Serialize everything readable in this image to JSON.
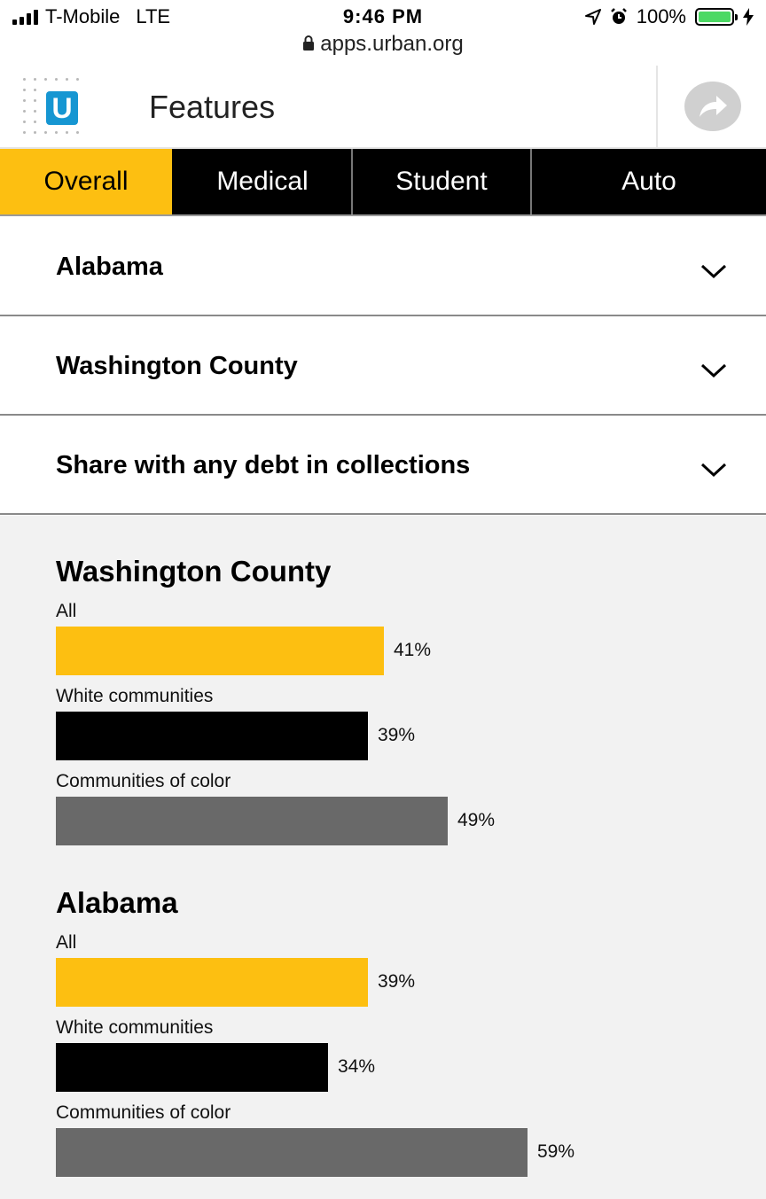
{
  "status_bar": {
    "carrier": "T-Mobile",
    "network": "LTE",
    "time": "9:46 PM",
    "battery": "100%",
    "battery_level": 1.0
  },
  "browser": {
    "url": "apps.urban.org"
  },
  "header": {
    "logo_letter": "U",
    "title": "Features",
    "share_icon": "share-arrow-icon"
  },
  "tabs": [
    {
      "label": "Overall",
      "active": true
    },
    {
      "label": "Medical",
      "active": false
    },
    {
      "label": "Student",
      "active": false
    },
    {
      "label": "Auto",
      "active": false
    }
  ],
  "dropdowns": {
    "state": "Alabama",
    "county": "Washington County",
    "metric": "Share with any debt in collections"
  },
  "colors": {
    "all": "#fdbf11",
    "white": "#000000",
    "color": "#696969",
    "accent_blue": "#1696d2"
  },
  "chart_data": [
    {
      "type": "bar",
      "title": "Washington County",
      "categories": [
        "All",
        "White communities",
        "Communities of color"
      ],
      "values": [
        41,
        39,
        49
      ],
      "value_labels": [
        "41%",
        "39%",
        "49%"
      ]
    },
    {
      "type": "bar",
      "title": "Alabama",
      "categories": [
        "All",
        "White communities",
        "Communities of color"
      ],
      "values": [
        39,
        34,
        59
      ],
      "value_labels": [
        "39%",
        "34%",
        "59%"
      ]
    }
  ]
}
